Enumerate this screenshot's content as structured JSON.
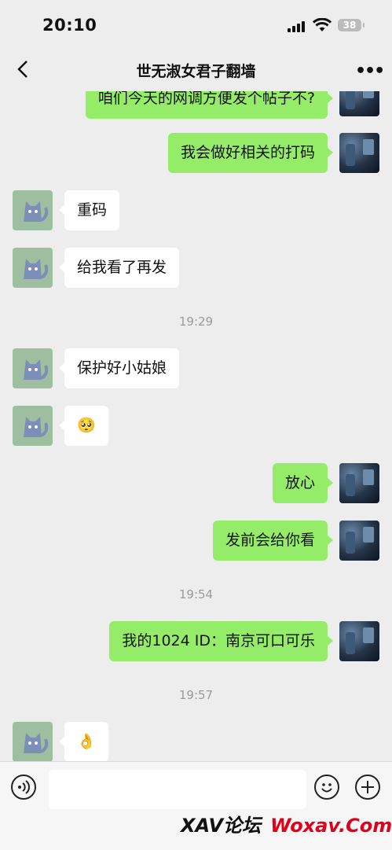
{
  "status_bar": {
    "time": "20:10",
    "battery": "38"
  },
  "header": {
    "title": "世无淑女君子翻墙"
  },
  "messages": {
    "m0": "咱们今天的网调方便发个帖子不?",
    "m1": "我会做好相关的打码",
    "m2": "重码",
    "m3": "给我看了再发",
    "t1": "19:29",
    "m4": "保护好小姑娘",
    "m5": "🥺",
    "m6": "放心",
    "m7": "发前会给你看",
    "t2": "19:54",
    "m8": "我的1024 ID：南京可口可乐",
    "t3": "19:57",
    "m9": "👌"
  },
  "input": {
    "placeholder": ""
  },
  "watermark": {
    "part1": "XAV论坛",
    "part2": "Woxav.Com"
  },
  "icons": {
    "back": "chevron-left-icon",
    "more": "more-dots-icon",
    "voice": "voice-icon",
    "emoji": "emoji-icon",
    "plus": "plus-icon",
    "signal": "signal-icon",
    "wifi": "wifi-icon",
    "battery": "battery-icon"
  },
  "colors": {
    "my_bubble": "#95ec69",
    "other_bubble": "#ffffff",
    "background": "#ededed",
    "watermark_red": "#e0001b"
  }
}
